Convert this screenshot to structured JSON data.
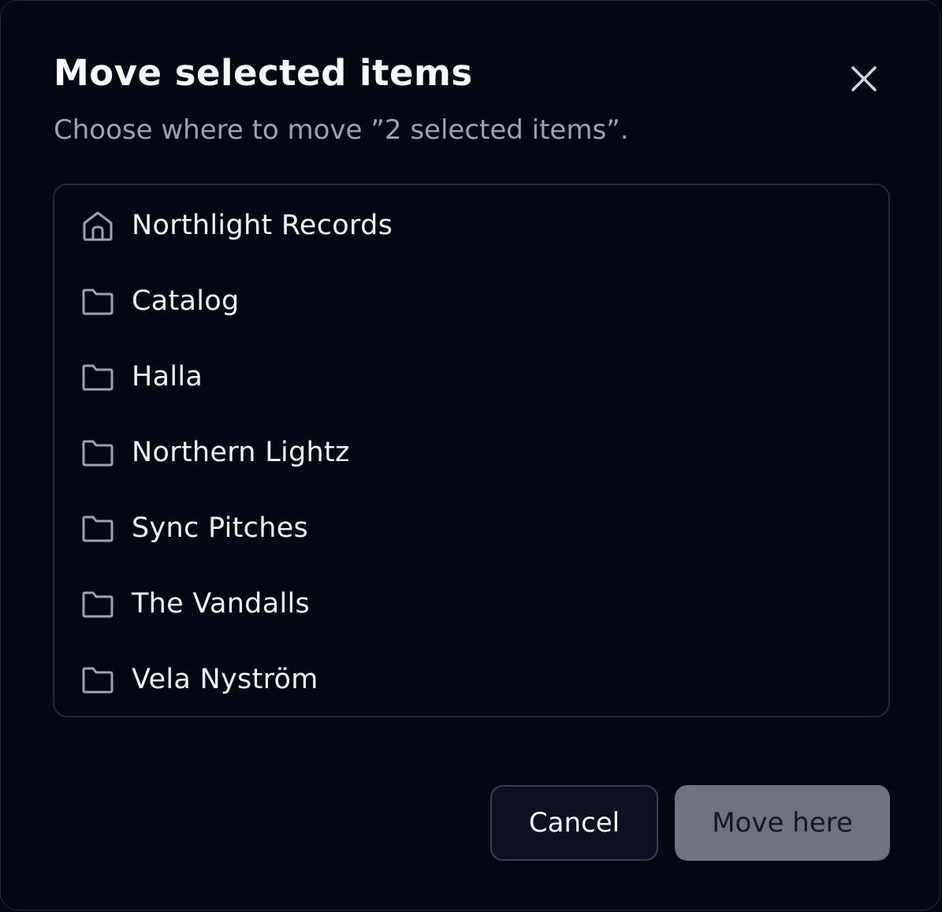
{
  "dialog": {
    "title": "Move selected items",
    "subtitle": "Choose where to move ”2 selected items”.",
    "close_icon": "close-icon"
  },
  "folders": [
    {
      "label": "Northlight Records",
      "icon": "home-icon"
    },
    {
      "label": "Catalog",
      "icon": "folder-icon"
    },
    {
      "label": "Halla",
      "icon": "folder-icon"
    },
    {
      "label": "Northern Lightz",
      "icon": "folder-icon"
    },
    {
      "label": "Sync Pitches",
      "icon": "folder-icon"
    },
    {
      "label": "The Vandalls",
      "icon": "folder-icon"
    },
    {
      "label": "Vela Nyström",
      "icon": "folder-icon"
    }
  ],
  "actions": {
    "cancel_label": "Cancel",
    "move_label": "Move here"
  },
  "colors": {
    "background": "#030712",
    "border": "#1f2937",
    "primary_disabled": "#6b7280",
    "muted_text": "#9ca3af"
  }
}
